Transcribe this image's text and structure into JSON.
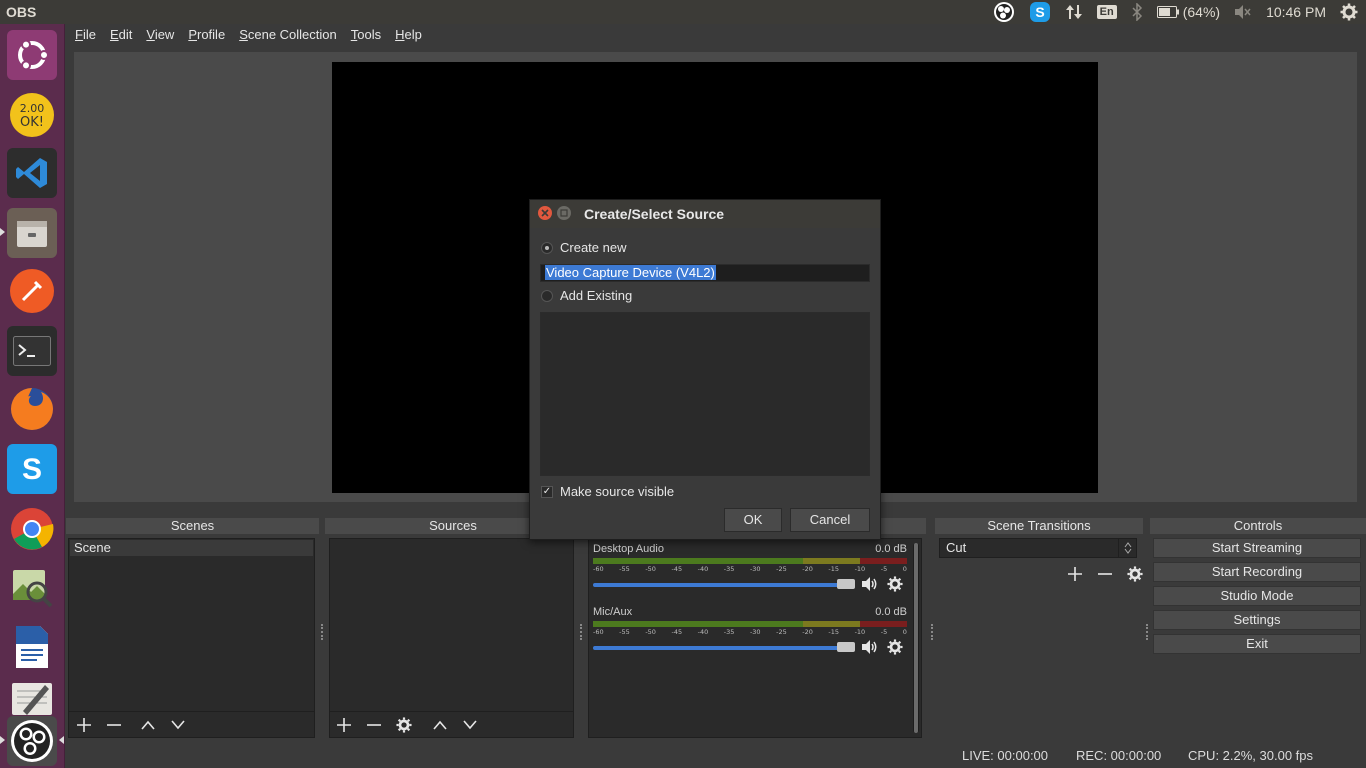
{
  "top_panel": {
    "app_title": "OBS",
    "battery": "(64%)",
    "language": "En",
    "clock": "10:46 PM"
  },
  "launcher": {
    "items": [
      "ubuntu-dash",
      "2do",
      "vscode",
      "files",
      "postman",
      "terminal",
      "firefox",
      "skype",
      "chrome",
      "image-viewer",
      "writer",
      "text-editor",
      "obs"
    ]
  },
  "menubar": {
    "items": [
      "File",
      "Edit",
      "View",
      "Profile",
      "Scene Collection",
      "Tools",
      "Help"
    ]
  },
  "docks": {
    "scenes_title": "Scenes",
    "sources_title": "Sources",
    "transitions_title": "Scene Transitions",
    "controls_title": "Controls",
    "scene_items": [
      "Scene"
    ]
  },
  "mixer": {
    "channels": [
      {
        "name": "Desktop Audio",
        "db": "0.0 dB"
      },
      {
        "name": "Mic/Aux",
        "db": "0.0 dB"
      }
    ],
    "ticks": [
      "-60",
      "-55",
      "-50",
      "-45",
      "-40",
      "-35",
      "-30",
      "-25",
      "-20",
      "-15",
      "-10",
      "-5",
      "0"
    ]
  },
  "transitions": {
    "selected": "Cut"
  },
  "controls": {
    "start_streaming": "Start Streaming",
    "start_recording": "Start Recording",
    "studio_mode": "Studio Mode",
    "settings": "Settings",
    "exit": "Exit"
  },
  "statusbar": {
    "live": "LIVE: 00:00:00",
    "rec": "REC: 00:00:00",
    "cpu": "CPU: 2.2%, 30.00 fps"
  },
  "dialog": {
    "title": "Create/Select Source",
    "create_new": "Create new",
    "name_value": "Video Capture Device (V4L2)",
    "add_existing": "Add Existing",
    "make_visible": "Make source visible",
    "ok": "OK",
    "cancel": "Cancel"
  },
  "colors": {
    "launcher_bg": "#5b2c4d",
    "panel_bg": "#3c3b37",
    "selection": "#3d7ad4"
  }
}
